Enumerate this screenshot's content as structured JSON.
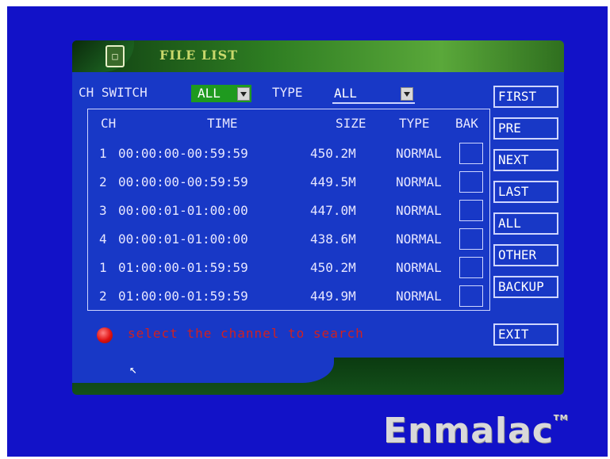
{
  "window": {
    "title": "FILE LIST"
  },
  "filters": {
    "ch_switch_label": "CH SWITCH",
    "ch_switch_value": "ALL",
    "type_label": "TYPE",
    "type_value": "ALL"
  },
  "table": {
    "headers": [
      "CH",
      "TIME",
      "SIZE",
      "TYPE",
      "BAK"
    ],
    "rows": [
      {
        "ch": "1",
        "time": "00:00:00-00:59:59",
        "size": "450.2M",
        "type": "NORMAL"
      },
      {
        "ch": "2",
        "time": "00:00:00-00:59:59",
        "size": "449.5M",
        "type": "NORMAL"
      },
      {
        "ch": "3",
        "time": "00:00:01-01:00:00",
        "size": "447.0M",
        "type": "NORMAL"
      },
      {
        "ch": "4",
        "time": "00:00:01-01:00:00",
        "size": "438.6M",
        "type": "NORMAL"
      },
      {
        "ch": "1",
        "time": "01:00:00-01:59:59",
        "size": "450.2M",
        "type": "NORMAL"
      },
      {
        "ch": "2",
        "time": "01:00:00-01:59:59",
        "size": "449.9M",
        "type": "NORMAL"
      }
    ]
  },
  "side_buttons": {
    "first": "FIRST",
    "pre": "PRE",
    "next": "NEXT",
    "last": "LAST",
    "all": "ALL",
    "other": "OTHER",
    "backup": "BACKUP",
    "exit": "EXIT"
  },
  "status": {
    "message": "select the channel to search"
  },
  "watermark": {
    "brand": "Enmalac",
    "tm": "TM"
  },
  "colors": {
    "screen_bg": "#1212c8",
    "panel_bg": "#1838c6",
    "title_green": "#2e7d22",
    "status_red": "#d02020",
    "selected_combo": "#1f9a1f"
  },
  "icons": [
    "file-list-icon",
    "dropdown-arrow-icon",
    "record-red-icon",
    "mouse-pointer-icon"
  ]
}
